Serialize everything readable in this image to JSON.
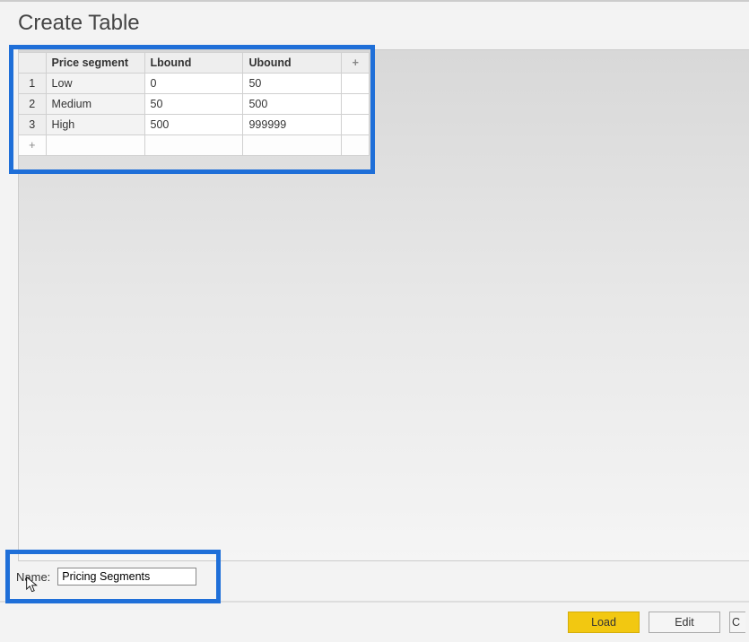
{
  "title": "Create Table",
  "table": {
    "headers": {
      "segment": "Price segment",
      "lbound": "Lbound",
      "ubound": "Ubound",
      "add": "+"
    },
    "rows": [
      {
        "n": "1",
        "segment": "Low",
        "lbound": "0",
        "ubound": "50"
      },
      {
        "n": "2",
        "segment": "Medium",
        "lbound": "50",
        "ubound": "500"
      },
      {
        "n": "3",
        "segment": "High",
        "lbound": "500",
        "ubound": "999999"
      }
    ],
    "add_row_marker": "+"
  },
  "name_field": {
    "label": "Name:",
    "value": "Pricing Segments"
  },
  "buttons": {
    "load": "Load",
    "edit": "Edit",
    "cancel_partial": "C"
  }
}
